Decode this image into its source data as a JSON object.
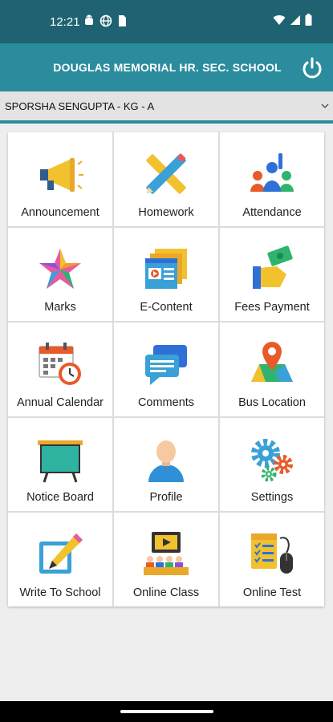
{
  "status_bar": {
    "time": "12:21"
  },
  "header": {
    "title": "DOUGLAS MEMORIAL HR. SEC. SCHOOL",
    "power_icon": "power-icon"
  },
  "student": {
    "label": "SPORSHA SENGUPTA - KG - A"
  },
  "menu": {
    "items": [
      {
        "label": "Announcement",
        "icon": "megaphone-icon"
      },
      {
        "label": "Homework",
        "icon": "pencil-ruler-icon"
      },
      {
        "label": "Attendance",
        "icon": "people-raised-hand-icon"
      },
      {
        "label": "Marks",
        "icon": "star-icon"
      },
      {
        "label": "E-Content",
        "icon": "video-screens-icon"
      },
      {
        "label": "Fees Payment",
        "icon": "hand-money-icon"
      },
      {
        "label": "Annual Calendar",
        "icon": "calendar-clock-icon"
      },
      {
        "label": "Comments",
        "icon": "chat-bubbles-icon"
      },
      {
        "label": "Bus Location",
        "icon": "map-pin-icon"
      },
      {
        "label": "Notice Board",
        "icon": "board-icon"
      },
      {
        "label": "Profile",
        "icon": "user-icon"
      },
      {
        "label": "Settings",
        "icon": "gears-icon"
      },
      {
        "label": "Write To School",
        "icon": "write-pencil-icon"
      },
      {
        "label": "Online Class",
        "icon": "online-class-icon"
      },
      {
        "label": "Online Test",
        "icon": "test-mouse-icon"
      }
    ]
  },
  "colors": {
    "status_bar": "#1f6271",
    "app_bar": "#2b8c9e"
  }
}
